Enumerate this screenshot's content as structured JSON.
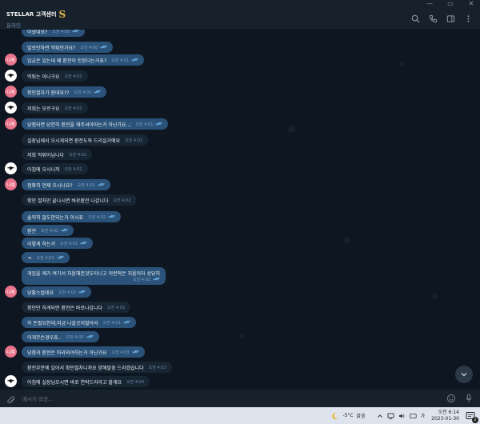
{
  "window": {
    "controls": [
      "—",
      "▭",
      "✕"
    ]
  },
  "header": {
    "title": "STELLAR 고객센터",
    "title_mark": "S",
    "status": "온라인"
  },
  "colors": {
    "bg": "#0e1621",
    "incoming": "#182533",
    "outgoing": "#2b5278",
    "accent": "#5ea9dd"
  },
  "messages": [
    {
      "avatar": "",
      "side": "out",
      "text": "이셨네요?",
      "time": "오전 4:00",
      "read": true
    },
    {
      "avatar": "",
      "side": "out",
      "text": "말로만하면 먹튀인가요?",
      "time": "오전 4:00",
      "read": true
    },
    {
      "avatar": "니예",
      "side": "out",
      "text": "입금은 있는데 왜 환전이 안된다는거죠?",
      "time": "오전 4:01",
      "read": true
    },
    {
      "avatar": "bird",
      "side": "in",
      "text": "먹튀는 아니구요",
      "time": "오전 4:01",
      "read": false
    },
    {
      "avatar": "니예",
      "side": "out",
      "text": "확인절차가 뭔데요??",
      "time": "오전 4:01",
      "read": true
    },
    {
      "avatar": "bird",
      "side": "in",
      "text": "저희는 모르구요",
      "time": "오전 4:01",
      "read": false
    },
    {
      "avatar": "니예",
      "side": "out",
      "text": "당첨되면 당연히 환전을 해주셔야하는거 아닌가요..;",
      "time": "오전 4:01",
      "read": true
    },
    {
      "avatar": "",
      "side": "in",
      "text": "실장님께서 오시게되면 환전도와 드리실거예요",
      "time": "오전 4:01",
      "read": false
    },
    {
      "avatar": "",
      "side": "in",
      "text": "저희 먹튀아닙니다",
      "time": "오전 4:01",
      "read": false
    },
    {
      "avatar": "bird",
      "side": "in",
      "text": "아침에 오시니까",
      "time": "오전 4:01",
      "read": false
    },
    {
      "avatar": "니예",
      "side": "out",
      "text": "정확히 언제 오시나요?",
      "time": "오전 4:02",
      "read": true
    },
    {
      "avatar": "",
      "side": "in",
      "text": "확인 절차만 끝나시면 바로환전 나갑니다",
      "time": "오전 4:02",
      "read": false
    },
    {
      "avatar": "",
      "side": "out",
      "text": "솔직히 말도안되는거 아시죠",
      "time": "오전 4:02",
      "read": true
    },
    {
      "avatar": "",
      "side": "out",
      "text": "환전",
      "time": "오전 4:02",
      "read": true
    },
    {
      "avatar": "",
      "side": "out",
      "text": "이렇게 하는거",
      "time": "오전 4:02",
      "read": true
    },
    {
      "avatar": "",
      "side": "out",
      "text": "ㅋ",
      "time": "오전 4:02",
      "read": true
    },
    {
      "avatar": "",
      "side": "out",
      "text": "게임을 제가 여기서 처음해본것두아니고 이런적은 처음이라 상당히",
      "time": "오전 4:02",
      "read": true
    },
    {
      "avatar": "니예",
      "side": "out",
      "text": "당황스럽네요",
      "time": "오전 4:02",
      "read": true
    },
    {
      "avatar": "",
      "side": "in",
      "text": "확인만 하게되면 환전은 바로나갑니다",
      "time": "오전 4:03",
      "read": false
    },
    {
      "avatar": "",
      "side": "out",
      "text": "하 돈필요한데;지금 나갈곳이많아서",
      "time": "오전 4:03",
      "read": true
    },
    {
      "avatar": "",
      "side": "out",
      "text": "이게무슨경우죠..",
      "time": "오전 4:03",
      "read": true
    },
    {
      "avatar": "니예",
      "side": "out",
      "text": "당첨과 환전은 따라와야하는거 아닌가요",
      "time": "오전 4:03",
      "read": true
    },
    {
      "avatar": "",
      "side": "in",
      "text": "환전부분에 있어서 확인절차니까요 양해말씀 드리겠습니다",
      "time": "오전 4:03",
      "read": false
    },
    {
      "avatar": "bird",
      "side": "in",
      "text": "아침에 실장님오시면 바로 연락드리라고 할게요",
      "time": "오전 4:04",
      "read": false
    }
  ],
  "input": {
    "placeholder": "메시지 작성..."
  },
  "taskbar": {
    "weather_temp": "-5°C",
    "weather_text": "맑음",
    "ime": "가",
    "time": "오전 6:14",
    "date": "2023-01-30",
    "notif_count": "2"
  }
}
